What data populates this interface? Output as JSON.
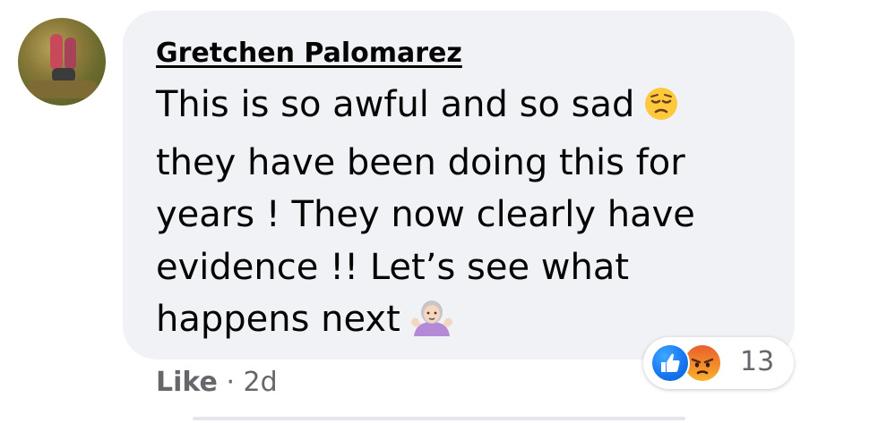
{
  "comment": {
    "author": "Gretchen Palomarez",
    "lines": [
      "This is so awful and so sad",
      "they have been doing this for",
      "years ! They now clearly have",
      "evidence !! Let’s see what",
      "happens next"
    ],
    "emoji_after_line1": "pensive-face-emoji",
    "emoji_after_line5": "woman-shrugging-emoji"
  },
  "reactions": {
    "types": [
      "like-reaction-icon",
      "angry-reaction-icon"
    ],
    "count": "13"
  },
  "actions": {
    "like_label": "Like",
    "separator": "·",
    "timestamp": "2d"
  },
  "colors": {
    "bubble": "#f0f2f5",
    "text": "#050505",
    "secondary": "#65676b",
    "like_blue": "#1877f2"
  }
}
